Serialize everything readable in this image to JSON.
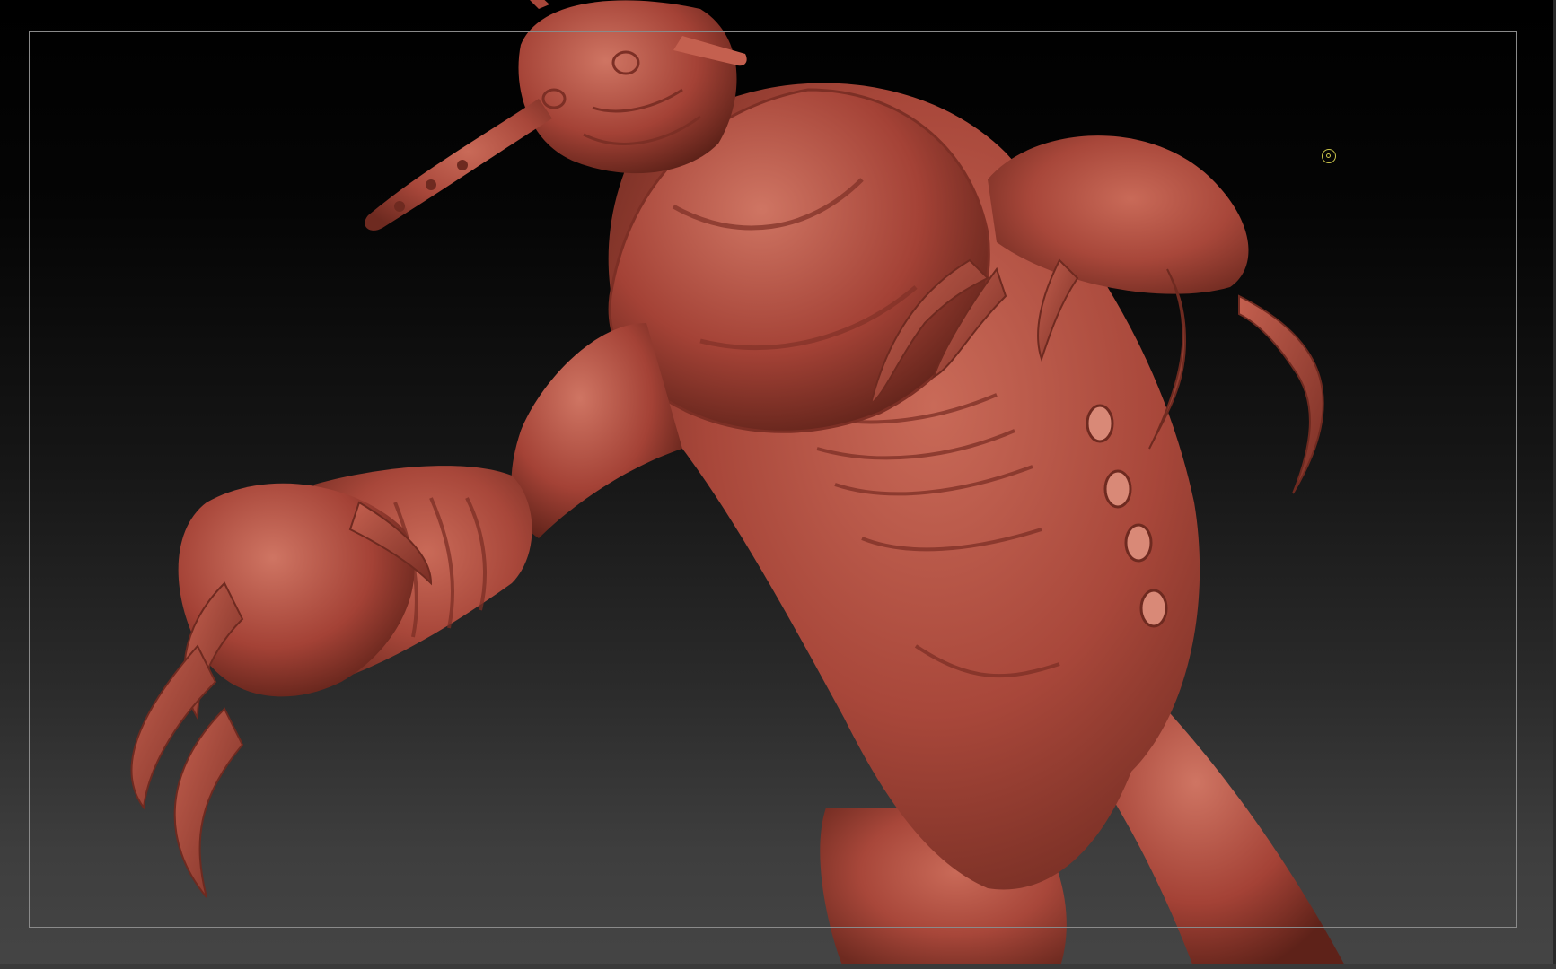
{
  "viewport": {
    "background_top": "#000000",
    "background_bottom": "#454545",
    "frame_color": "#8a8a8a"
  },
  "model": {
    "material_color": "#a8473a",
    "highlight_color": "#c96a58",
    "shadow_color": "#5e2219",
    "icon": "creature-sculpt"
  },
  "pivot": {
    "color": "#c9c34a",
    "icon": "pivot-target-icon"
  }
}
